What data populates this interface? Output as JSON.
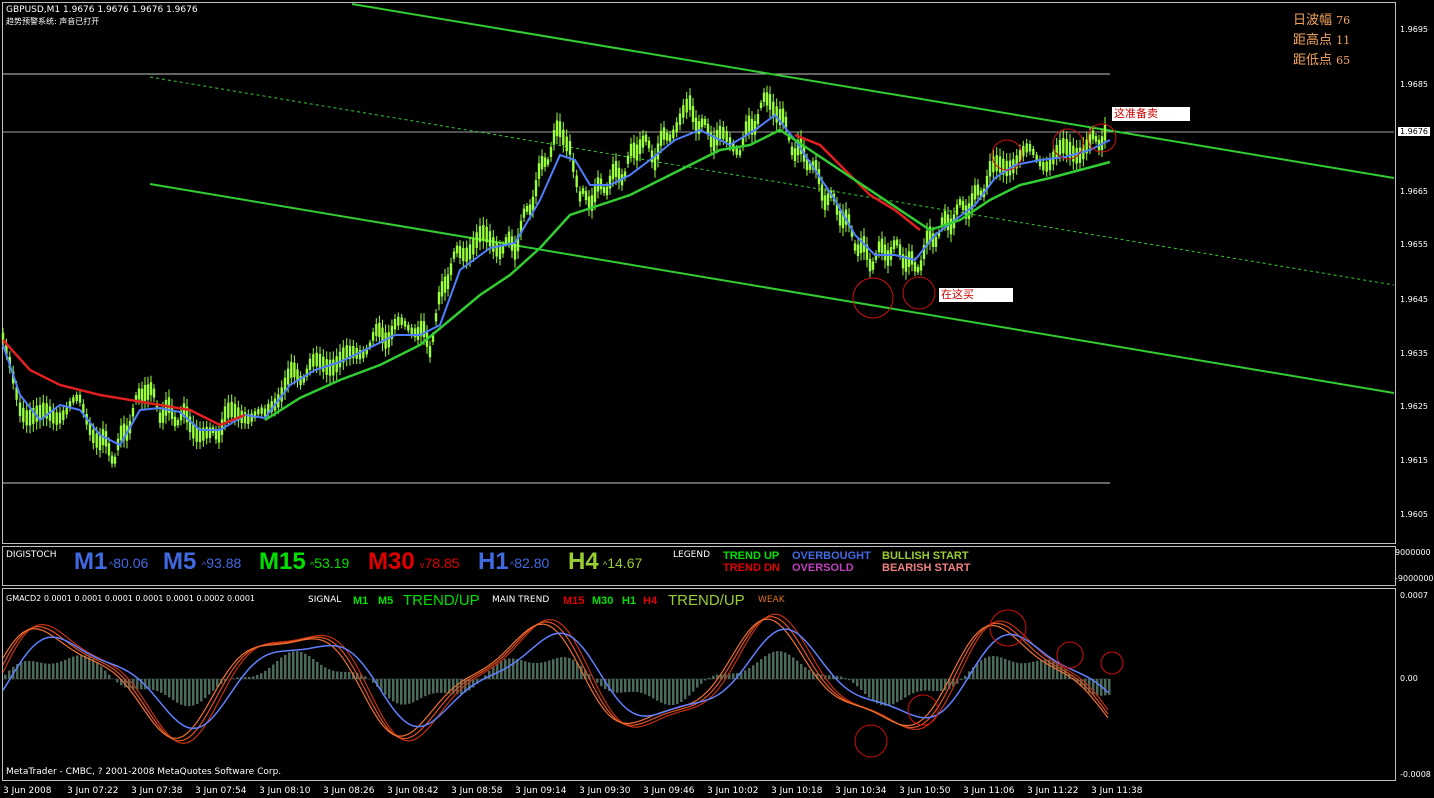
{
  "header": {
    "symbol_line": "GBPUSD,M1  1.9676 1.9676 1.9676 1.9676",
    "indicator_line": "趋势预警系统: 声音已打开"
  },
  "info_box": {
    "lines": [
      {
        "label": "日波幅",
        "value": "76"
      },
      {
        "label": "距高点",
        "value": "11"
      },
      {
        "label": "距低点",
        "value": "65"
      }
    ]
  },
  "annotations": {
    "sell": "这准备卖",
    "buy": "在这买"
  },
  "price_axis": {
    "ticks": [
      "1.9695",
      "1.9685",
      "1.9676",
      "1.9665",
      "1.9655",
      "1.9645",
      "1.9635",
      "1.9625",
      "1.9615",
      "1.9605"
    ],
    "current": "1.9676"
  },
  "digistoch": {
    "title": "DIGISTOCH",
    "timeframes": [
      {
        "name": "M1",
        "arrow": "^",
        "value": "80.06",
        "color": "#4169e1"
      },
      {
        "name": "M5",
        "arrow": "^",
        "value": "93.88",
        "color": "#4169e1"
      },
      {
        "name": "M15",
        "arrow": "^",
        "value": "53.19",
        "color": "#00e000"
      },
      {
        "name": "M30",
        "arrow": "v",
        "value": "78.85",
        "color": "#e00000"
      },
      {
        "name": "H1",
        "arrow": "^",
        "value": "82.80",
        "color": "#4169e1"
      },
      {
        "name": "H4",
        "arrow": "^",
        "value": "14.67",
        "color": "#9acd32"
      }
    ],
    "legend_title": "LEGEND",
    "legend": [
      {
        "text": "TREND UP",
        "color": "#00e000"
      },
      {
        "text": "TREND DN",
        "color": "#e00000"
      },
      {
        "text": "OVERBOUGHT",
        "color": "#4169e1"
      },
      {
        "text": "OVERSOLD",
        "color": "#c040c0"
      },
      {
        "text": "BULLISH START",
        "color": "#9acd32"
      },
      {
        "text": "BEARISH START",
        "color": "#f08080"
      }
    ],
    "axis_top": "9000000",
    "axis_bottom": "-9000000"
  },
  "gmacd": {
    "title": "GMACD2 0.0001 0.0001 0.0001 0.0001 0.0001 0.0002 0.0001",
    "signal_label": "SIGNAL",
    "signal_m1": "M1",
    "signal_m5": "M5",
    "signal_trend": "TREND/UP",
    "main_label": "MAIN TREND",
    "main_m15": "M15",
    "main_m30": "M30",
    "main_h1": "H1",
    "main_h4": "H4",
    "main_trend": "TREND/UP",
    "weak": "WEAK",
    "axis_top": "0.0007",
    "axis_mid": "0.00",
    "axis_bottom": "-0.0008"
  },
  "copyright": "MetaTrader - CMBC, ? 2001-2008 MetaQuotes Software Corp.",
  "time_axis": [
    "3 Jun 2008",
    "3 Jun 07:22",
    "3 Jun 07:38",
    "3 Jun 07:54",
    "3 Jun 08:10",
    "3 Jun 08:26",
    "3 Jun 08:42",
    "3 Jun 08:58",
    "3 Jun 09:14",
    "3 Jun 09:30",
    "3 Jun 09:46",
    "3 Jun 10:02",
    "3 Jun 10:18",
    "3 Jun 10:34",
    "3 Jun 10:50",
    "3 Jun 11:06",
    "3 Jun 11:22",
    "3 Jun 11:38"
  ],
  "colors": {
    "candles": "#9aff3a",
    "channel": "#32cd32",
    "ma_blue": "#4f7fff",
    "ma_red": "#e02020",
    "ma_green": "#32cd32",
    "circles": "#d01010"
  }
}
